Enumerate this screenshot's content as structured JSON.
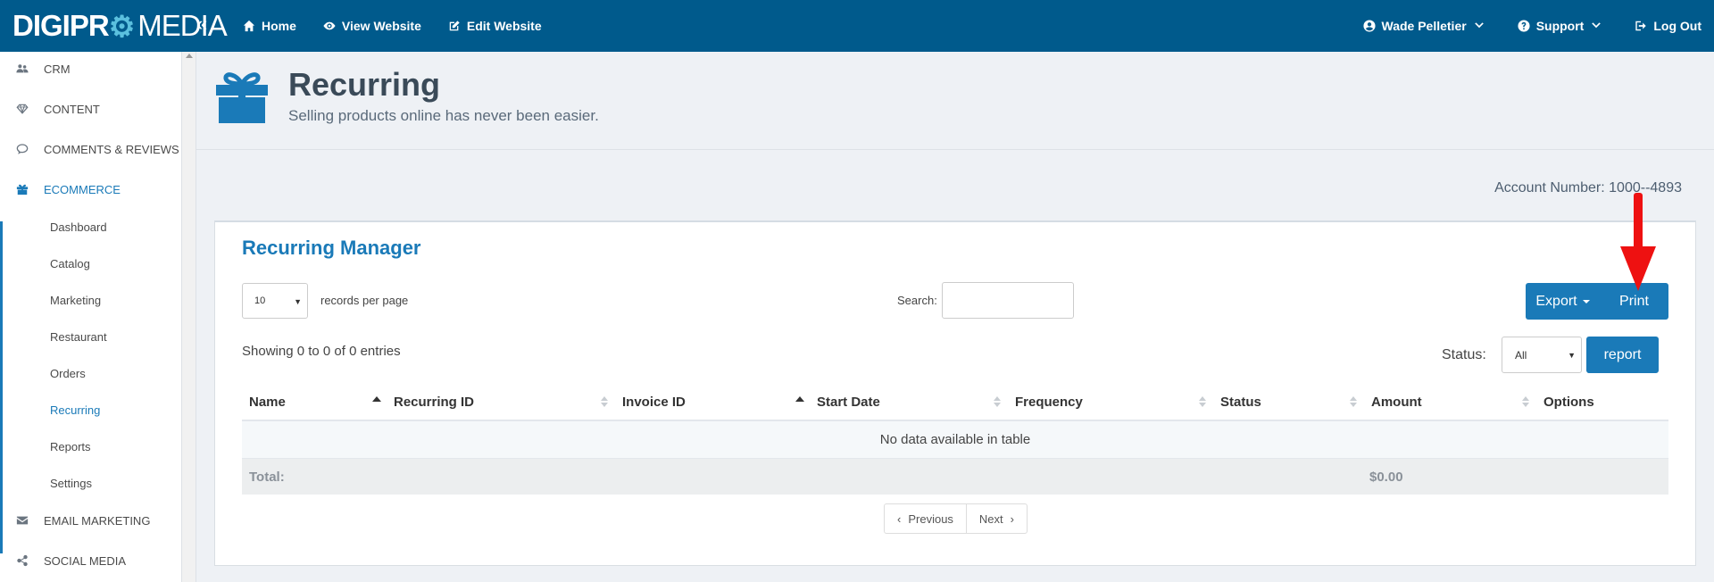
{
  "brand": {
    "part1": "DIGIPR",
    "part2": "⚙",
    "part3": "MEDIA"
  },
  "topnav": [
    {
      "label": "Home",
      "icon": "home-icon"
    },
    {
      "label": "View Website",
      "icon": "eye-icon"
    },
    {
      "label": "Edit Website",
      "icon": "edit-icon"
    }
  ],
  "user": {
    "name": "Wade Pelletier",
    "support": "Support",
    "logout": "Log Out"
  },
  "sidebar": {
    "sections": [
      "CRM",
      "CONTENT",
      "COMMENTS & REVIEWS",
      "ECOMMERCE",
      "EMAIL MARKETING",
      "SOCIAL MEDIA"
    ],
    "ecommerce_items": [
      "Dashboard",
      "Catalog",
      "Marketing",
      "Restaurant",
      "Orders",
      "Recurring",
      "Reports",
      "Settings"
    ]
  },
  "header": {
    "title": "Recurring",
    "subtitle": "Selling products online has never been easier."
  },
  "account": {
    "text": "Account Number: 1000--4893"
  },
  "panel": {
    "title": "Recurring Manager",
    "page_length": "10",
    "records_label": "records per page",
    "search_label": "Search:",
    "search_value": "",
    "export_label": "Export",
    "print_label": "Print",
    "showing": "Showing 0 to 0 of 0 entries",
    "status_label": "Status:",
    "status_value": "All",
    "report_label": "report"
  },
  "table": {
    "columns": [
      "Name",
      "Recurring ID",
      "Invoice ID",
      "Start Date",
      "Frequency",
      "Status",
      "Amount",
      "Options"
    ],
    "empty_message": "No data available in table",
    "total_label": "Total:",
    "total_amount": "$0.00"
  },
  "pagination": {
    "previous": "Previous",
    "next": "Next"
  },
  "colors": {
    "primary": "#1a7ab8",
    "topbar": "#005a8c",
    "annotation": "#ee1111"
  }
}
